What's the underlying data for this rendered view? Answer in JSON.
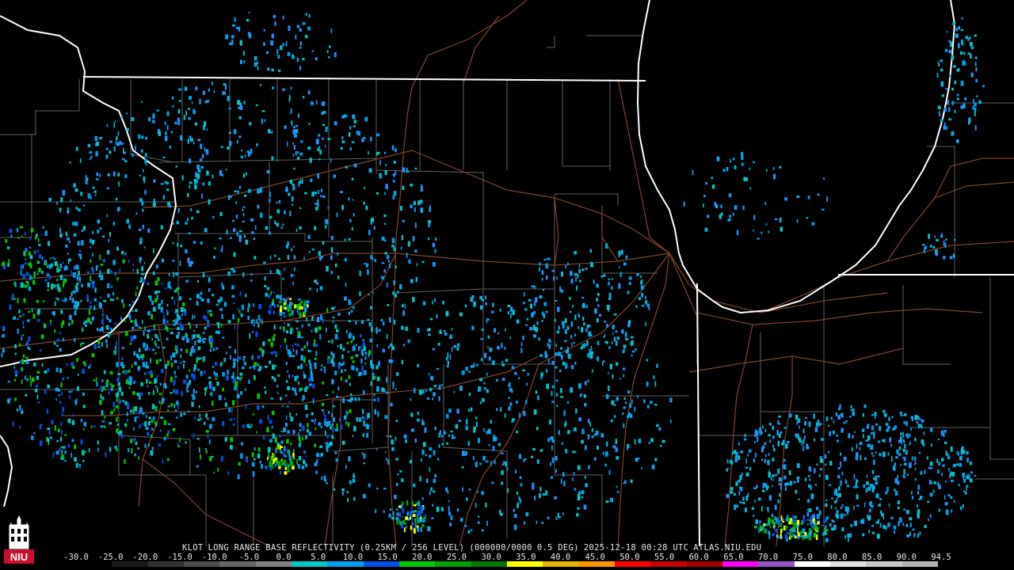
{
  "product": {
    "radar": "KLOT",
    "product_name": "LONG RANGE BASE REFLECTIVITY",
    "resolution": "(0.25KM / 256 LEVEL)",
    "vcp": "(000000/0000",
    "tilt": "0.5 DEG)",
    "datetime": "2025-12-18 00:28 UTC",
    "source": "ATLAS.NIU.EDU"
  },
  "logo": {
    "text": "NIU",
    "name": "niu-logo-icon"
  },
  "colorscale": {
    "labels": [
      "-30.0",
      "-25.0",
      "-20.0",
      "-15.0",
      "-10.0",
      "-5.0",
      "0.0",
      "5.0",
      "10.0",
      "15.0",
      "20.0",
      "25.0",
      "30.0",
      "35.0",
      "40.0",
      "45.0",
      "50.0",
      "55.0",
      "60.0",
      "65.0",
      "70.0",
      "75.0",
      "80.0",
      "85.0",
      "90.0",
      "94.5"
    ],
    "colors": [
      "#000000",
      "#1a1a1a",
      "#333333",
      "#4d4d4d",
      "#666666",
      "#808080",
      "#00c8c8",
      "#00a0f0",
      "#0050e6",
      "#00c800",
      "#00a000",
      "#007800",
      "#ffff00",
      "#e6b400",
      "#ff9600",
      "#ff0000",
      "#c80000",
      "#a00000",
      "#ff00ff",
      "#9650c8",
      "#ffffff",
      "#e0e0e0",
      "#c8c8c8",
      "#b4b4b4"
    ]
  }
}
